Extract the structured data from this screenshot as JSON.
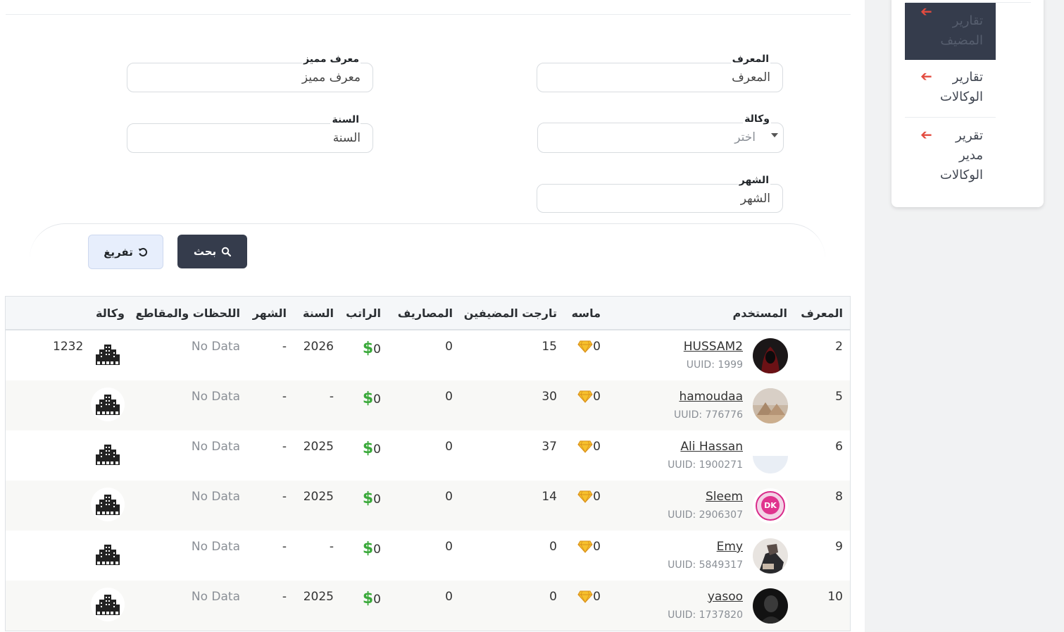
{
  "nav": {
    "items": [
      {
        "label": "تقارير المضيف",
        "active": true
      },
      {
        "label": "تقارير الوكالات",
        "active": false
      },
      {
        "label": "تقرير مدير الوكالات",
        "active": false
      }
    ]
  },
  "filters": {
    "id": {
      "label": "المعرف",
      "placeholder": "المعرف"
    },
    "unique_id": {
      "label": "معرف مميز",
      "placeholder": "معرف مميز"
    },
    "agency": {
      "label": "وكالة",
      "placeholder": "اختر"
    },
    "year": {
      "label": "السنة",
      "placeholder": "السنة"
    },
    "month": {
      "label": "الشهر",
      "placeholder": "الشهر"
    }
  },
  "actions": {
    "search": "بحث",
    "reset": "تفريغ"
  },
  "table": {
    "headers": {
      "id": "المعرف",
      "user": "المستخدم",
      "diamond": "ماسه",
      "guests": "تارجت المضيفين",
      "expenses": "المصاريف",
      "salary": "الراتب",
      "year": "السنة",
      "month": "الشهر",
      "moments": "اللحظات والمقاطع",
      "agency": "وكالة"
    },
    "rows": [
      {
        "id": "2",
        "username": "HUSSAM2",
        "uuid": "UUID: 1999",
        "diamond": "0",
        "guests": "15",
        "expenses": "0",
        "salary": "0",
        "year": "2026",
        "month": "-",
        "moments": "No Data",
        "agency": "1232"
      },
      {
        "id": "5",
        "username": "hamoudaa",
        "uuid": "UUID: 776776",
        "diamond": "0",
        "guests": "30",
        "expenses": "0",
        "salary": "0",
        "year": "-",
        "month": "-",
        "moments": "No Data",
        "agency": ""
      },
      {
        "id": "6",
        "username": "Ali Hassan",
        "uuid": "UUID: 1900271",
        "diamond": "0",
        "guests": "37",
        "expenses": "0",
        "salary": "0",
        "year": "2025",
        "month": "-",
        "moments": "No Data",
        "agency": ""
      },
      {
        "id": "8",
        "username": "Sleem",
        "uuid": "UUID: 2906307",
        "diamond": "0",
        "guests": "14",
        "expenses": "0",
        "salary": "0",
        "year": "2025",
        "month": "-",
        "moments": "No Data",
        "agency": ""
      },
      {
        "id": "9",
        "username": "Emy",
        "uuid": "UUID: 5849317",
        "diamond": "0",
        "guests": "0",
        "expenses": "0",
        "salary": "0",
        "year": "-",
        "month": "-",
        "moments": "No Data",
        "agency": ""
      },
      {
        "id": "10",
        "username": "yasoo",
        "uuid": "UUID: 1737820",
        "diamond": "0",
        "guests": "0",
        "expenses": "0",
        "salary": "0",
        "year": "2025",
        "month": "-",
        "moments": "No Data",
        "agency": ""
      }
    ],
    "currency_symbol": "$"
  },
  "colors": {
    "primary": "#353c4c",
    "accent_red": "#e34b3f",
    "money_green": "#3aa93a",
    "diamond_gold": "#f2b01e"
  }
}
